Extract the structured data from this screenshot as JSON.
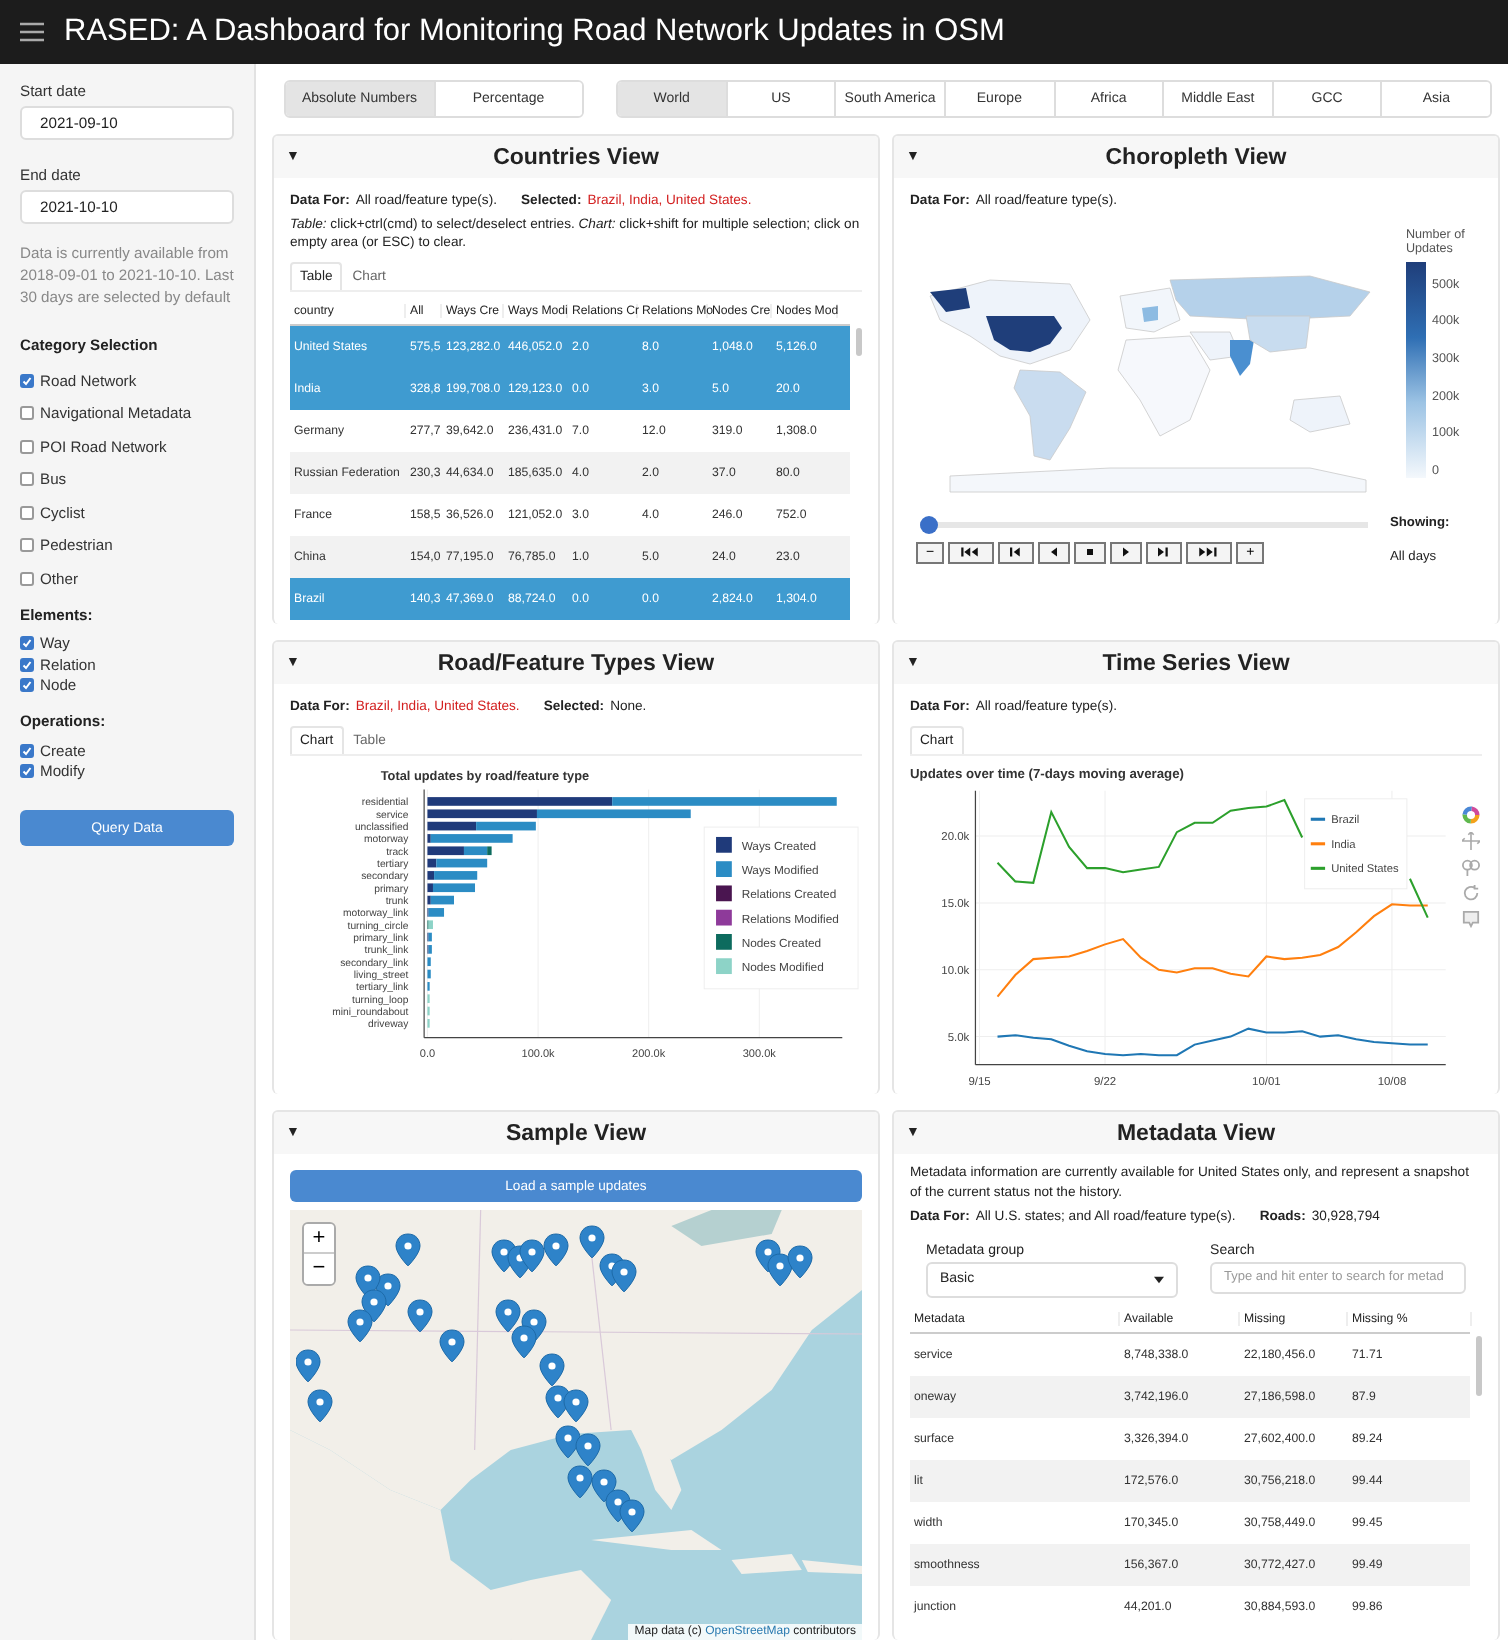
{
  "header": {
    "title": "RASED: A Dashboard for Monitoring Road Network Updates in OSM"
  },
  "sidebar": {
    "start_date": {
      "label": "Start date",
      "value": "2021-09-10"
    },
    "end_date": {
      "label": "End date",
      "value": "2021-10-10"
    },
    "note": "Data is currently available from 2018-09-01 to 2021-10-10. Last 30 days are selected by default",
    "groups": [
      {
        "title": "Category Selection",
        "options": [
          {
            "label": "Road Network",
            "checked": true
          },
          {
            "label": "Navigational Metadata",
            "checked": false
          },
          {
            "label": "POI Road Network",
            "checked": false
          },
          {
            "label": "Bus",
            "checked": false
          },
          {
            "label": "Cyclist",
            "checked": false
          },
          {
            "label": "Pedestrian",
            "checked": false
          },
          {
            "label": "Other",
            "checked": false
          }
        ]
      },
      {
        "title": "Elements:",
        "options": [
          {
            "label": "Way",
            "checked": true
          },
          {
            "label": "Relation",
            "checked": true
          },
          {
            "label": "Node",
            "checked": true
          }
        ]
      },
      {
        "title": "Operations:",
        "options": [
          {
            "label": "Create",
            "checked": true
          },
          {
            "label": "Modify",
            "checked": true
          }
        ]
      }
    ],
    "query_button": "Query Data"
  },
  "measure_tabs": [
    {
      "label": "Absolute Numbers",
      "selected": true
    },
    {
      "label": "Percentage",
      "selected": false
    }
  ],
  "region_tabs": [
    {
      "label": "World",
      "selected": true
    },
    {
      "label": "US",
      "selected": false
    },
    {
      "label": "South America",
      "selected": false
    },
    {
      "label": "Europe",
      "selected": false
    },
    {
      "label": "Africa",
      "selected": false
    },
    {
      "label": "Middle East",
      "selected": false
    },
    {
      "label": "GCC",
      "selected": false
    },
    {
      "label": "Asia",
      "selected": false
    }
  ],
  "countries_view": {
    "toggle": "▼",
    "title": "Countries View",
    "info": [
      {
        "label": "Data For:",
        "value": "All road/feature type(s).",
        "highlight": false
      },
      {
        "label": "Selected:",
        "value": "Brazil, India, United States.",
        "highlight": true
      }
    ],
    "hint": "*Table:* click+ctrl(cmd) to select/deselect entries. *Chart:* click+shift for multiple selection; click on empty area (or ESC) to clear.",
    "tabs": [
      {
        "label": "Table",
        "selected": true
      },
      {
        "label": "Chart",
        "selected": false
      }
    ],
    "table": {
      "columns": [
        "country",
        "All",
        "Ways Cre",
        "Ways Modi",
        "Relations Cr",
        "Relations Mo",
        "Nodes Cre",
        "Nodes Mod"
      ],
      "rows": [
        {
          "selected": true,
          "cells": [
            "United States",
            "575,5",
            "123,282.0",
            "446,052.0",
            "2.0",
            "8.0",
            "1,048.0",
            "5,126.0"
          ]
        },
        {
          "selected": true,
          "cells": [
            "India",
            "328,8",
            "199,708.0",
            "129,123.0",
            "0.0",
            "3.0",
            "5.0",
            "20.0"
          ]
        },
        {
          "selected": false,
          "cells": [
            "Germany",
            "277,7",
            "39,642.0",
            "236,431.0",
            "7.0",
            "12.0",
            "319.0",
            "1,308.0"
          ]
        },
        {
          "selected": false,
          "cells": [
            "Russian Federation",
            "230,3",
            "44,634.0",
            "185,635.0",
            "4.0",
            "2.0",
            "37.0",
            "80.0"
          ]
        },
        {
          "selected": false,
          "cells": [
            "France",
            "158,5",
            "36,526.0",
            "121,052.0",
            "3.0",
            "4.0",
            "246.0",
            "752.0"
          ]
        },
        {
          "selected": false,
          "cells": [
            "China",
            "154,0",
            "77,195.0",
            "76,785.0",
            "1.0",
            "5.0",
            "24.0",
            "23.0"
          ]
        },
        {
          "selected": true,
          "cells": [
            "Brazil",
            "140,3",
            "47,369.0",
            "88,724.0",
            "0.0",
            "0.0",
            "2,824.0",
            "1,304.0"
          ]
        }
      ]
    }
  },
  "choropleth_view": {
    "toggle": "▼",
    "title": "Choropleth View",
    "info": [
      {
        "label": "Data For:",
        "value": "All road/feature type(s).",
        "highlight": false
      }
    ],
    "colorbar": {
      "title": "Number of Updates",
      "ticks": [
        "500k",
        "400k",
        "300k",
        "200k",
        "100k",
        "0"
      ]
    },
    "slider": {
      "level": 0
    },
    "player_buttons": [
      {
        "kind": "text",
        "label": "−"
      },
      {
        "kind": "first"
      },
      {
        "kind": "previous"
      },
      {
        "kind": "reverse"
      },
      {
        "kind": "pause"
      },
      {
        "kind": "play"
      },
      {
        "kind": "next"
      },
      {
        "kind": "last"
      },
      {
        "kind": "text",
        "label": "+"
      }
    ],
    "showing_label": "Showing:",
    "showing_value": "All days"
  },
  "road_types_view": {
    "toggle": "▼",
    "title": "Road/Feature Types View",
    "info": [
      {
        "label": "Data For:",
        "value": "Brazil, India, United States.",
        "highlight": true
      },
      {
        "label": "Selected:",
        "value": "None.",
        "highlight": false
      }
    ],
    "tabs": [
      {
        "label": "Chart",
        "selected": true
      },
      {
        "label": "Table",
        "selected": false
      }
    ],
    "chart_data": {
      "type": "bar",
      "orientation": "horizontal",
      "stacked": true,
      "grid": true,
      "legend": true,
      "title": "Total updates by road/feature type",
      "categories": [
        "residential",
        "service",
        "unclassified",
        "motorway",
        "track",
        "tertiary",
        "secondary",
        "primary",
        "trunk",
        "motorway_link",
        "turning_circle",
        "primary_link",
        "trunk_link",
        "secondary_link",
        "living_street",
        "tertiary_link",
        "turning_loop",
        "mini_roundabout",
        "driveway"
      ],
      "series": [
        {
          "name": "Ways Created",
          "color": "#1f3a7a",
          "values": [
            167000,
            99000,
            44000,
            3000,
            33000,
            8000,
            6000,
            5000,
            3000,
            1000,
            0,
            1000,
            1000,
            0,
            0,
            0,
            0,
            0,
            0
          ]
        },
        {
          "name": "Ways Modified",
          "color": "#2b8cc4",
          "values": [
            203000,
            139000,
            54000,
            74000,
            21000,
            46000,
            39000,
            38000,
            21000,
            14000,
            0,
            3000,
            3000,
            3000,
            3000,
            2000,
            0,
            0,
            0
          ]
        },
        {
          "name": "Relations Created",
          "color": "#4a1550",
          "values": [
            0,
            0,
            0,
            0,
            0,
            0,
            0,
            0,
            0,
            0,
            0,
            0,
            0,
            0,
            0,
            0,
            0,
            0,
            0
          ]
        },
        {
          "name": "Relations Modified",
          "color": "#8e3a9a",
          "values": [
            0,
            0,
            0,
            0,
            0,
            0,
            0,
            0,
            0,
            0,
            0,
            0,
            0,
            0,
            0,
            0,
            0,
            0,
            0
          ]
        },
        {
          "name": "Nodes Created",
          "color": "#0d6b5e",
          "values": [
            0,
            0,
            0,
            0,
            4000,
            0,
            0,
            0,
            0,
            0,
            1000,
            0,
            0,
            0,
            0,
            0,
            0,
            0,
            0
          ]
        },
        {
          "name": "Nodes Modified",
          "color": "#8dd3c7",
          "values": [
            0,
            0,
            0,
            0,
            0,
            0,
            0,
            0,
            0,
            0,
            4000,
            0,
            0,
            0,
            0,
            0,
            2000,
            2000,
            2000
          ]
        }
      ],
      "xlim": [
        -3000,
        375000
      ],
      "xticks": [
        {
          "value": 0,
          "label": "0.0"
        },
        {
          "value": 100000,
          "label": "100.0k"
        },
        {
          "value": 200000,
          "label": "200.0k"
        },
        {
          "value": 300000,
          "label": "300.0k"
        }
      ]
    }
  },
  "time_series_view": {
    "toggle": "▼",
    "title": "Time Series View",
    "info": [
      {
        "label": "Data For:",
        "value": "All road/feature type(s).",
        "highlight": false
      }
    ],
    "tabs": [
      {
        "label": "Chart",
        "selected": true
      }
    ],
    "chart_data": {
      "type": "line",
      "title": "Updates over time (7-days moving average)",
      "grid": true,
      "legend": true,
      "categories": [
        "9/15",
        null,
        null,
        null,
        null,
        null,
        null,
        "9/22",
        null,
        null,
        null,
        null,
        null,
        null,
        null,
        null,
        "10/01",
        null,
        null,
        null,
        null,
        null,
        null,
        "10/08",
        null,
        null
      ],
      "series": [
        {
          "name": "Brazil",
          "color": "#1f77b4",
          "values": [
            null,
            5000,
            5100,
            4900,
            4800,
            4300,
            3900,
            3700,
            3600,
            3700,
            3600,
            3600,
            4400,
            4700,
            5000,
            5600,
            5300,
            5300,
            5400,
            5000,
            5100,
            4800,
            4600,
            4500,
            4400,
            4400
          ]
        },
        {
          "name": "India",
          "color": "#ff7f0e",
          "values": [
            null,
            8000,
            9600,
            10800,
            10900,
            11000,
            11400,
            11900,
            12300,
            10900,
            10000,
            9800,
            10100,
            10100,
            9700,
            9500,
            11000,
            10800,
            10900,
            11100,
            11700,
            12800,
            14000,
            14900,
            14800,
            14800
          ]
        },
        {
          "name": "United States",
          "color": "#2ca02c",
          "values": [
            null,
            18000,
            16600,
            16500,
            21800,
            19200,
            17600,
            17600,
            17300,
            17500,
            17700,
            20300,
            21000,
            21000,
            21900,
            22100,
            22200,
            22700,
            19900,
            null,
            null,
            null,
            null,
            null,
            16800,
            13900
          ]
        }
      ],
      "ylim": [
        2900,
        23400
      ],
      "yticks": [
        {
          "value": 5000,
          "label": "5.0k"
        },
        {
          "value": 10000,
          "label": "10.0k"
        },
        {
          "value": 15000,
          "label": "15.0k"
        },
        {
          "value": 20000,
          "label": "20.0k"
        }
      ]
    }
  },
  "sample_view": {
    "toggle": "▼",
    "title": "Sample View",
    "load_button": "Load a sample updates",
    "map": {
      "kind": "picture",
      "zoom_in": "+",
      "zoom_out": "−",
      "attribution": {
        "before": "Map data (c)",
        "link": "OpenStreetMap",
        "after": "contributors"
      }
    }
  },
  "metadata_view": {
    "toggle": "▼",
    "title": "Metadata View",
    "description": "Metadata information are currently available for United States only, and represent a snapshot of the current status not the history.",
    "info": [
      {
        "label": "Data For:",
        "value": "All U.S. states; and All road/feature type(s).",
        "highlight": false
      },
      {
        "label": "Roads:",
        "value": "30,928,794",
        "highlight": false
      }
    ],
    "group_field": {
      "label": "Metadata group",
      "value": "Basic"
    },
    "search_field": {
      "label": "Search",
      "placeholder": "Type and hit enter to search for metad"
    },
    "table": {
      "columns": [
        "Metadata",
        "Available",
        "Missing",
        "Missing %"
      ],
      "rows": [
        [
          "service",
          "8,748,338.0",
          "22,180,456.0",
          "71.71"
        ],
        [
          "oneway",
          "3,742,196.0",
          "27,186,598.0",
          "87.9"
        ],
        [
          "surface",
          "3,326,394.0",
          "27,602,400.0",
          "89.24"
        ],
        [
          "lit",
          "172,576.0",
          "30,756,218.0",
          "99.44"
        ],
        [
          "width",
          "170,345.0",
          "30,758,449.0",
          "99.45"
        ],
        [
          "smoothness",
          "156,367.0",
          "30,772,427.0",
          "99.49"
        ],
        [
          "junction",
          "44,201.0",
          "30,884,593.0",
          "99.86"
        ]
      ]
    }
  }
}
